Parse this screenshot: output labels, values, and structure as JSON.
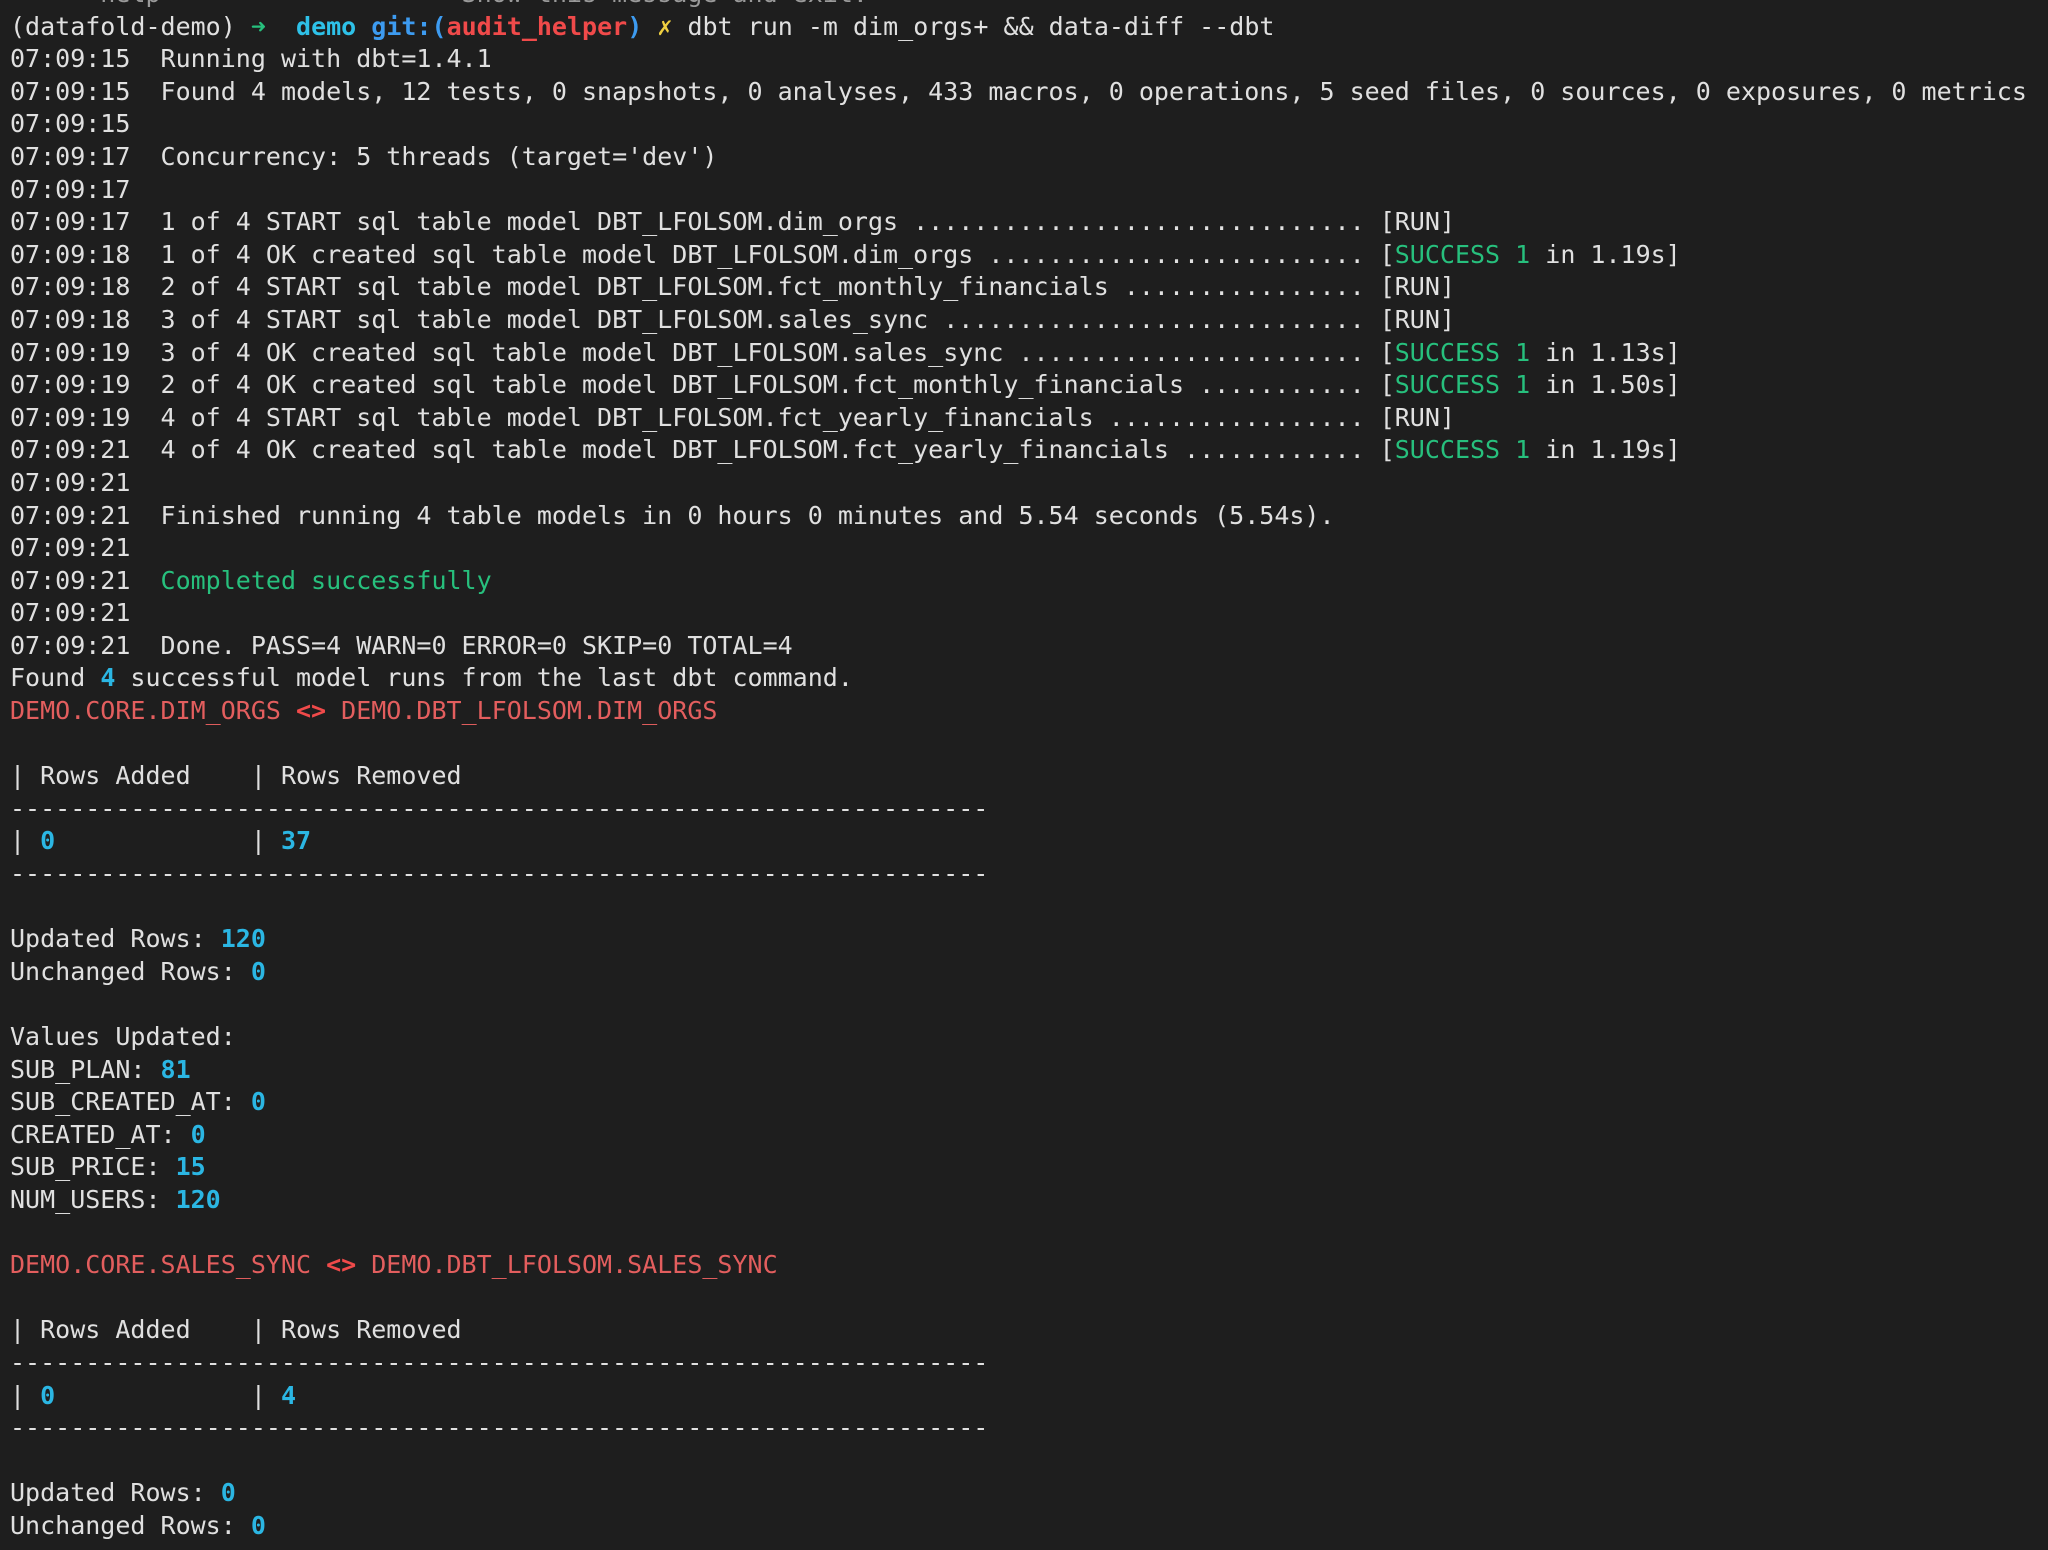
{
  "cutoff_line": "      help                    Show this message and exit.",
  "prompt": {
    "env": "(datafold-demo)",
    "arrow": "➜",
    "dir": "demo",
    "git_label": "git:(",
    "branch": "audit_helper",
    "git_close": ")",
    "dirty": "✗",
    "command": "dbt run -m dim_orgs+ && data-diff --dbt"
  },
  "log": [
    {
      "ts": "07:09:15",
      "text": "Running with dbt=1.4.1"
    },
    {
      "ts": "07:09:15",
      "text": "Found 4 models, 12 tests, 0 snapshots, 0 analyses, 433 macros, 0 operations, 5 seed files, 0 sources, 0 exposures, 0 metrics"
    },
    {
      "ts": "07:09:15",
      "text": ""
    },
    {
      "ts": "07:09:17",
      "text": "Concurrency: 5 threads (target='dev')"
    },
    {
      "ts": "07:09:17",
      "text": ""
    },
    {
      "ts": "07:09:17",
      "text": "1 of 4 START sql table model DBT_LFOLSOM.dim_orgs .............................. ",
      "status": "[RUN]"
    },
    {
      "ts": "07:09:18",
      "text": "1 of 4 OK created sql table model DBT_LFOLSOM.dim_orgs ......................... ",
      "success": "SUCCESS 1",
      "time": " in 1.19s]"
    },
    {
      "ts": "07:09:18",
      "text": "2 of 4 START sql table model DBT_LFOLSOM.fct_monthly_financials ................ ",
      "status": "[RUN]"
    },
    {
      "ts": "07:09:18",
      "text": "3 of 4 START sql table model DBT_LFOLSOM.sales_sync ............................ ",
      "status": "[RUN]"
    },
    {
      "ts": "07:09:19",
      "text": "3 of 4 OK created sql table model DBT_LFOLSOM.sales_sync ....................... ",
      "success": "SUCCESS 1",
      "time": " in 1.13s]"
    },
    {
      "ts": "07:09:19",
      "text": "2 of 4 OK created sql table model DBT_LFOLSOM.fct_monthly_financials ........... ",
      "success": "SUCCESS 1",
      "time": " in 1.50s]"
    },
    {
      "ts": "07:09:19",
      "text": "4 of 4 START sql table model DBT_LFOLSOM.fct_yearly_financials ................. ",
      "status": "[RUN]"
    },
    {
      "ts": "07:09:21",
      "text": "4 of 4 OK created sql table model DBT_LFOLSOM.fct_yearly_financials ............ ",
      "success": "SUCCESS 1",
      "time": " in 1.19s]"
    },
    {
      "ts": "07:09:21",
      "text": ""
    },
    {
      "ts": "07:09:21",
      "text": "Finished running 4 table models in 0 hours 0 minutes and 5.54 seconds (5.54s)."
    },
    {
      "ts": "07:09:21",
      "text": ""
    },
    {
      "ts": "07:09:21",
      "text": "Completed successfully",
      "green": true
    },
    {
      "ts": "07:09:21",
      "text": ""
    },
    {
      "ts": "07:09:21",
      "text": "Done. PASS=4 WARN=0 ERROR=0 SKIP=0 TOTAL=4"
    }
  ],
  "found": {
    "pre": "Found ",
    "count": "4",
    "post": " successful model runs from the last dbt command."
  },
  "diffs": [
    {
      "left": "DEMO.CORE.DIM_ORGS",
      "sep": " <> ",
      "right": "DEMO.DBT_LFOLSOM.DIM_ORGS",
      "col_added": "Rows Added",
      "col_removed": "Rows Removed",
      "rule": "-----------------------------------------------------------------",
      "rows_added": "0",
      "rows_removed": "37",
      "updated_label": "Updated Rows: ",
      "updated": "120",
      "unchanged_label": "Unchanged Rows: ",
      "unchanged": "0",
      "values_label": "Values Updated:",
      "values": [
        {
          "col": "SUB_PLAN: ",
          "val": "81"
        },
        {
          "col": "SUB_CREATED_AT: ",
          "val": "0"
        },
        {
          "col": "CREATED_AT: ",
          "val": "0"
        },
        {
          "col": "SUB_PRICE: ",
          "val": "15"
        },
        {
          "col": "NUM_USERS: ",
          "val": "120"
        }
      ]
    },
    {
      "left": "DEMO.CORE.SALES_SYNC",
      "sep": " <> ",
      "right": "DEMO.DBT_LFOLSOM.SALES_SYNC",
      "col_added": "Rows Added",
      "col_removed": "Rows Removed",
      "rule": "-----------------------------------------------------------------",
      "rows_added": "0",
      "rows_removed": "4",
      "updated_label": "Updated Rows: ",
      "updated": "0",
      "unchanged_label": "Unchanged Rows: ",
      "unchanged": "0"
    }
  ],
  "colors": {
    "background": "#1e1e1e",
    "text": "#e0e0e0",
    "success": "#27c07d",
    "number": "#2bb6e3",
    "table_name": "#e35e5e",
    "branch": "#f04a4a"
  }
}
